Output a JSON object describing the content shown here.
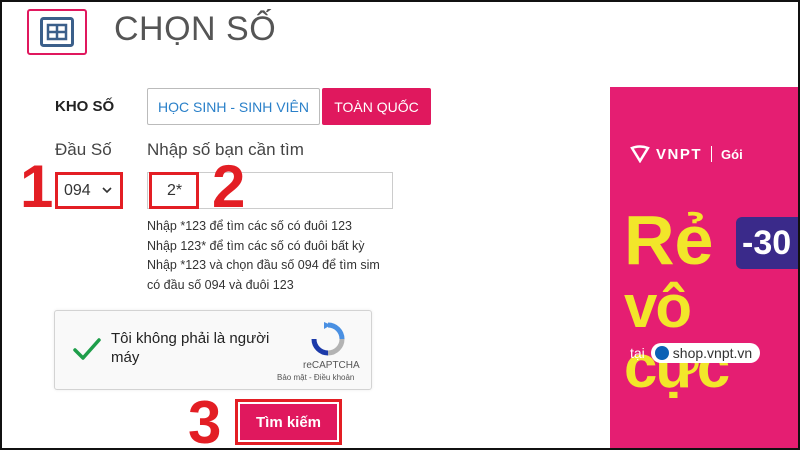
{
  "header": {
    "title": "CHỌN SỐ",
    "icon": "sim-card-icon"
  },
  "kho_so": {
    "label": "KHO SỐ",
    "tabs": [
      {
        "label": "HỌC SINH - SINH VIÊN",
        "active": false
      },
      {
        "label": "TOÀN QUỐC",
        "active": true
      }
    ]
  },
  "dau_so": {
    "label": "Đầu Số",
    "selected": "094"
  },
  "search_field": {
    "label": "Nhập số bạn cần tìm",
    "value": "2*"
  },
  "hints": [
    "Nhập *123 để tìm các số có đuôi 123",
    "Nhập 123* để tìm các số có đuôi bất kỳ",
    "Nhập *123 và chọn đầu số 094 để tìm sim",
    "có đầu số 094 và đuôi 123"
  ],
  "captcha": {
    "text": "Tôi không phải là người máy",
    "brand": "reCAPTCHA",
    "terms": "Bảo mật - Điều khoản"
  },
  "search_button": {
    "label": "Tìm kiếm"
  },
  "step_markers": [
    "1",
    "2",
    "3"
  ],
  "banner": {
    "brand": "VNPT",
    "goi": "Gói",
    "headline_1": "Rẻ",
    "discount": "-30",
    "headline_2": "vô cực",
    "shop_prefix": "tại",
    "shop_url": "shop.vnpt.vn"
  },
  "colors": {
    "accent": "#e0185e",
    "annotation_red": "#e31e24",
    "banner_bg": "#e51e72",
    "banner_yellow": "#f2e62a",
    "tab_text_blue": "#2a80c9"
  }
}
